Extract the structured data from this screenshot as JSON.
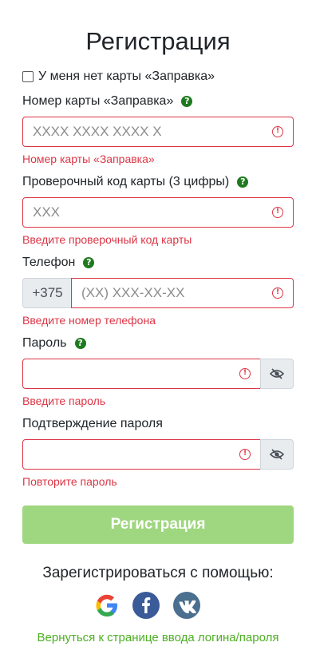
{
  "title": "Регистрация",
  "no_card": {
    "label": "У меня нет карты «Заправка»"
  },
  "card_number": {
    "label": "Номер карты «Заправка»",
    "placeholder": "XXXX XXXX XXXX X",
    "error": "Номер карты «Заправка»"
  },
  "card_code": {
    "label": "Проверочный код карты (3 цифры)",
    "placeholder": "XXX",
    "error": "Введите проверочный код карты"
  },
  "phone": {
    "label": "Телефон",
    "prefix": "+375",
    "placeholder": "(XX) XXX-XX-XX",
    "error": "Введите номер телефона"
  },
  "password": {
    "label": "Пароль",
    "error": "Введите пароль"
  },
  "password_confirm": {
    "label": "Подтверждение пароля",
    "error": "Повторите пароль"
  },
  "submit_label": "Регистрация",
  "social": {
    "title": "Зарегистрироваться с помощью:",
    "icons": [
      "google-icon",
      "facebook-icon",
      "vk-icon"
    ]
  },
  "back_link": "Вернуться к странице ввода логина/пароля",
  "colors": {
    "error": "#dc3545",
    "help": "#1f7a1f",
    "submit": "#9fd680",
    "link": "#4caf22"
  }
}
